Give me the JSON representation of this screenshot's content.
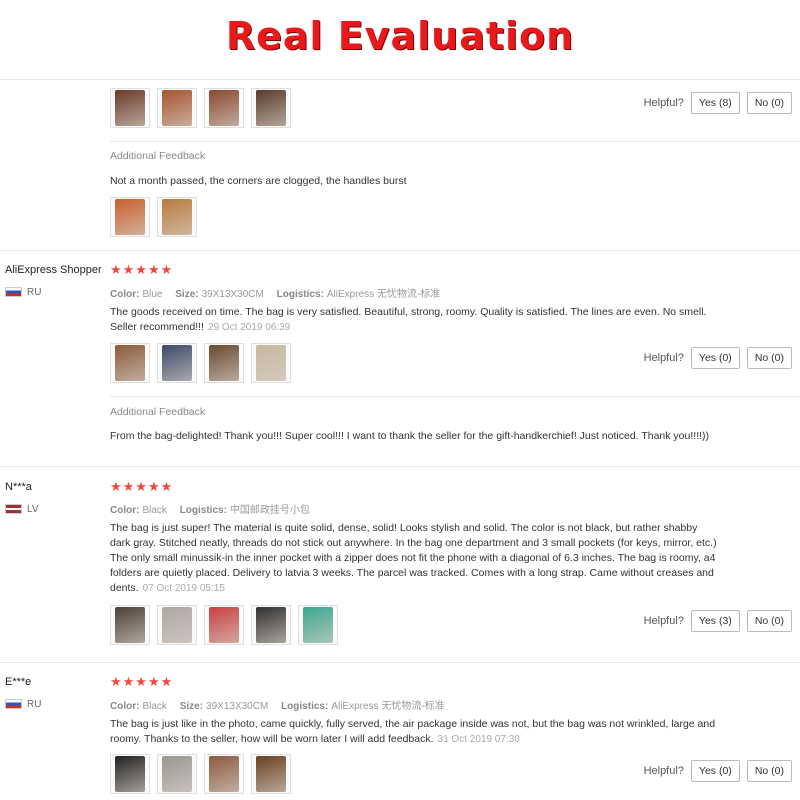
{
  "banner": "Real Evaluation",
  "helpful_label": "Helpful?",
  "review0": {
    "yes": "Yes (8)",
    "no": "No (0)",
    "additional_label": "Additional Feedback",
    "additional_text": "Not a month passed, the corners are clogged, the handles burst",
    "thumb_colors": [
      "#6b3a28",
      "#a6542e",
      "#8a4a30",
      "#5a3a2a"
    ],
    "add_thumb_colors": [
      "#c8602c",
      "#b97a3c"
    ]
  },
  "review1": {
    "name": "AliExpress Shopper",
    "country": "RU",
    "stars": "★★★★★",
    "color_label": "Color:",
    "color": "Blue",
    "size_label": "Size:",
    "size": "39X13X30CM",
    "logistics_label": "Logistics:",
    "logistics": "AliExpress 无忧物流-标准",
    "text": "The goods received on time. The bag is very satisfied. Beautiful, strong, roomy. Quality is satisfied. The lines are even. No smell. Seller recommend!!!",
    "date": "29 Oct 2019 06:39",
    "yes": "Yes (0)",
    "no": "No (0)",
    "additional_label": "Additional Feedback",
    "additional_text": "From the bag-delighted! Thank you!!! Super cool!!! I want to thank the seller for the gift-handkerchief! Just noticed. Thank you!!!!))",
    "thumb_colors": [
      "#8a5a38",
      "#3a4a6a",
      "#6a4a30",
      "#c8b8a0"
    ]
  },
  "review2": {
    "name": "N***a",
    "country": "LV",
    "stars": "★★★★★",
    "color_label": "Color:",
    "color": "Black",
    "logistics_label": "Logistics:",
    "logistics": "中国邮政挂号小包",
    "text": "The bag is just super! The material is quite solid, dense, solid! Looks stylish and solid. The color is not black, but rather shabby dark gray. Stitched neatly, threads do not stick out anywhere. In the bag one department and 3 small pockets (for keys, mirror, etc.) The only small minussik-in the inner pocket with a zipper does not fit the phone with a diagonal of 6.3 inches. The bag is roomy, a4 folders are quietly placed. Delivery to latvia 3 weeks. The parcel was tracked. Comes with a long strap. Came without creases and dents.",
    "date": "07 Oct 2019 05:15",
    "yes": "Yes (3)",
    "no": "No (0)",
    "thumb_colors": [
      "#4a4038",
      "#b0a8a0",
      "#c84040",
      "#303030",
      "#3aa890"
    ]
  },
  "review3": {
    "name": "E***e",
    "country": "RU",
    "stars": "★★★★★",
    "color_label": "Color:",
    "color": "Black",
    "size_label": "Size:",
    "size": "39X13X30CM",
    "logistics_label": "Logistics:",
    "logistics": "AliExpress 无忧物流-标准",
    "text": "The bag is just like in the photo, came quickly, fully served, the air package inside was not, but the bag was not wrinkled, large and roomy. Thanks to the seller, how will be worn later I will add feedback.",
    "date": "31 Oct 2019 07:30",
    "yes": "Yes (0)",
    "no": "No (0)",
    "thumb_colors": [
      "#222222",
      "#9a9890",
      "#8a5a40",
      "#6a4020"
    ]
  }
}
